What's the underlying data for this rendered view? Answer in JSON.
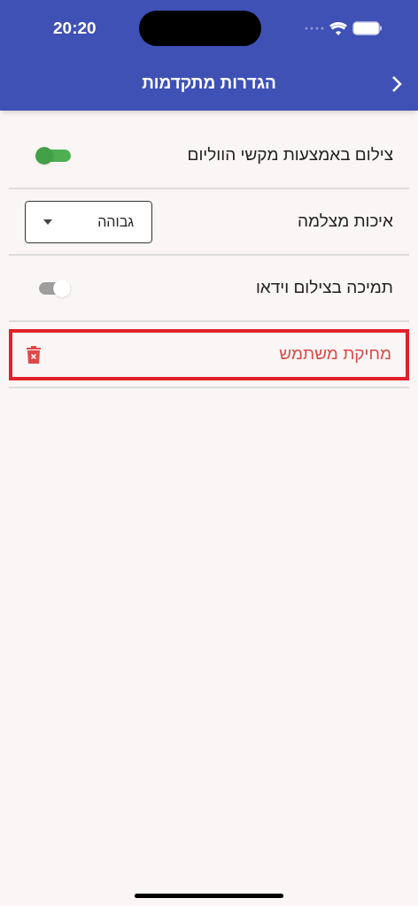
{
  "status_bar": {
    "time": "20:20"
  },
  "header": {
    "title": "הגדרות מתקדמות"
  },
  "settings": [
    {
      "kind": "toggle",
      "label": "צילום באמצעות מקשי הווליום",
      "on": true
    },
    {
      "kind": "select",
      "label": "איכות מצלמה",
      "value": "גבוהה"
    },
    {
      "kind": "toggle",
      "label": "תמיכה בצילום וידאו",
      "on": false
    },
    {
      "kind": "action",
      "label": "מחיקת משתמש",
      "highlighted": true
    }
  ]
}
